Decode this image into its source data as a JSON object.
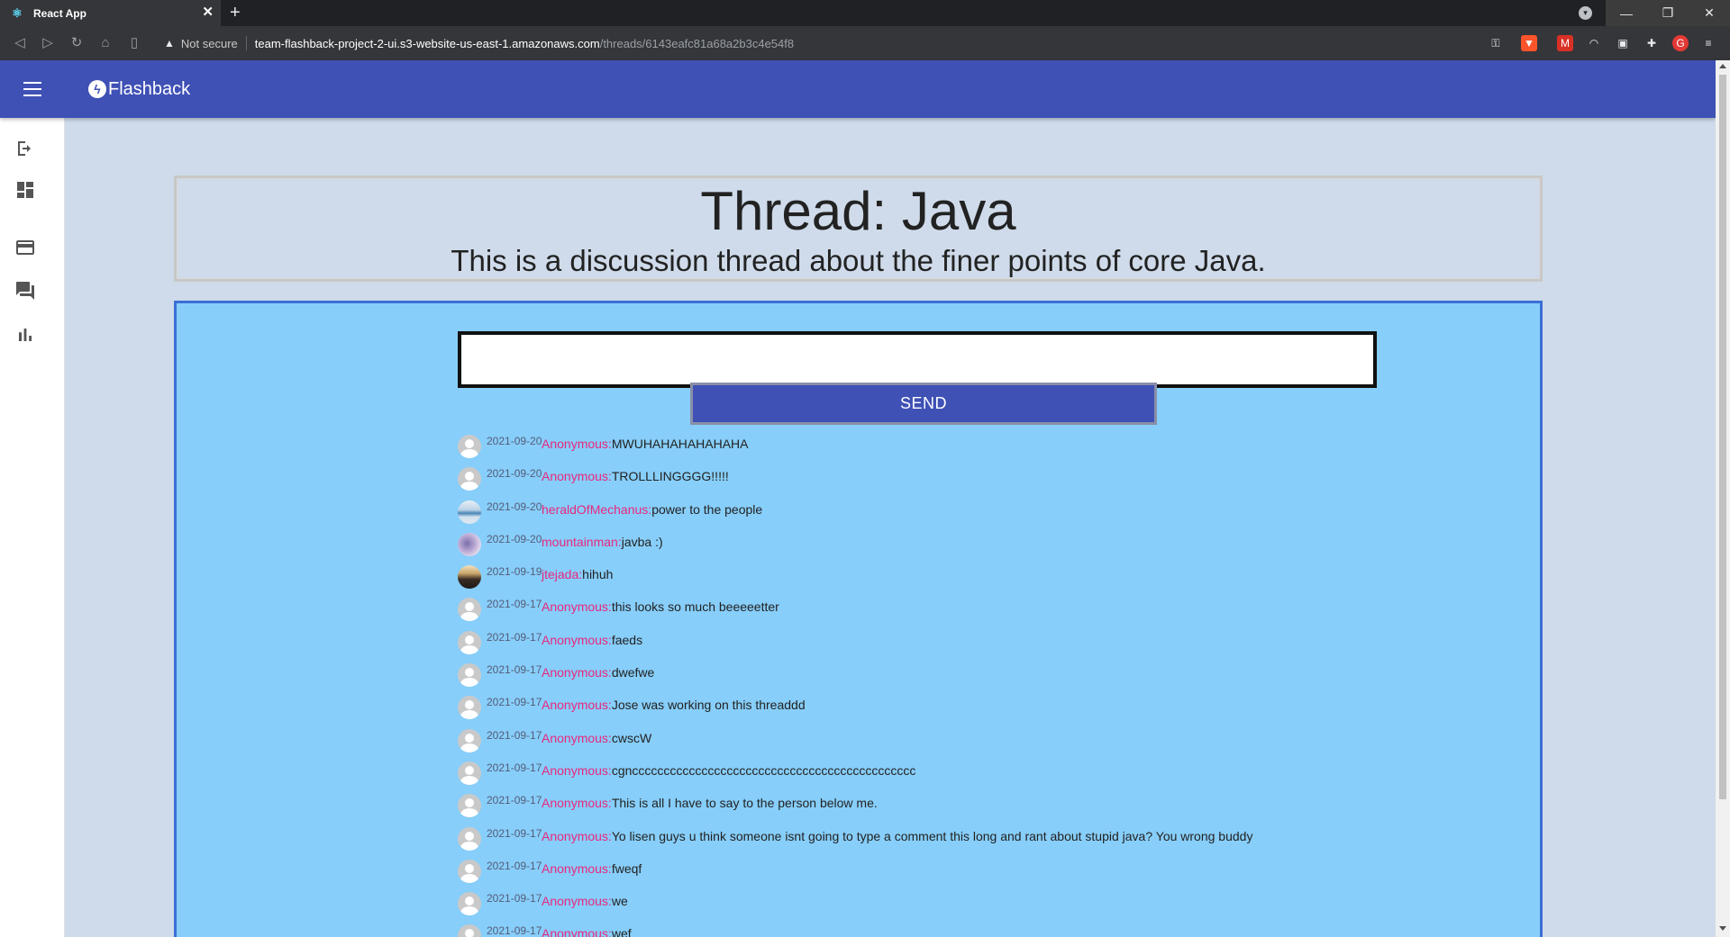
{
  "browser": {
    "tab_title": "React App",
    "security_label": "Not secure",
    "url_host": "team-flashback-project-2-ui.s3-website-us-east-1.amazonaws.com",
    "url_path": "/threads/6143eafc81a68a2b3c4e54f8"
  },
  "app": {
    "brand": "Flashback",
    "accent_color": "#3f51b5",
    "sidebar_icons": [
      "logout-icon",
      "dashboard-icon",
      "card-icon",
      "forum-icon",
      "bar-chart-icon"
    ]
  },
  "thread": {
    "title": "Thread: Java",
    "description": "This is a discussion thread about the finer points of core Java."
  },
  "chat": {
    "input_value": "",
    "send_label": "SEND",
    "messages": [
      {
        "date": "2021-09-20",
        "user": "Anonymous:",
        "text": "MWUHAHAHAHAHAHA",
        "avatar": "default"
      },
      {
        "date": "2021-09-20",
        "user": "Anonymous:",
        "text": "TROLLLINGGGG!!!!!",
        "avatar": "default"
      },
      {
        "date": "2021-09-20",
        "user": "heraldOfMechanus:",
        "text": "power to the people",
        "avatar": "sea"
      },
      {
        "date": "2021-09-20",
        "user": "mountainman:",
        "text": "javba :)",
        "avatar": "lilac"
      },
      {
        "date": "2021-09-19",
        "user": "jtejada:",
        "text": "hihuh",
        "avatar": "room"
      },
      {
        "date": "2021-09-17",
        "user": "Anonymous:",
        "text": "this looks so much beeeeetter",
        "avatar": "default"
      },
      {
        "date": "2021-09-17",
        "user": "Anonymous:",
        "text": "faeds",
        "avatar": "default"
      },
      {
        "date": "2021-09-17",
        "user": "Anonymous:",
        "text": "dwefwe",
        "avatar": "default"
      },
      {
        "date": "2021-09-17",
        "user": "Anonymous:",
        "text": "Jose was working on this threaddd",
        "avatar": "default"
      },
      {
        "date": "2021-09-17",
        "user": "Anonymous:",
        "text": "cwscW",
        "avatar": "default"
      },
      {
        "date": "2021-09-17",
        "user": "Anonymous:",
        "text": "cgnccccccccccccccccccccccccccccccccccccccccccccc",
        "avatar": "default"
      },
      {
        "date": "2021-09-17",
        "user": "Anonymous:",
        "text": "This is all I have to say to the person below me.",
        "avatar": "default"
      },
      {
        "date": "2021-09-17",
        "user": "Anonymous:",
        "text": "Yo lisen guys u think someone isnt going to type a comment this long and rant about stupid java? You wrong buddy",
        "avatar": "default"
      },
      {
        "date": "2021-09-17",
        "user": "Anonymous:",
        "text": "fweqf",
        "avatar": "default"
      },
      {
        "date": "2021-09-17",
        "user": "Anonymous:",
        "text": "we",
        "avatar": "default"
      },
      {
        "date": "2021-09-17",
        "user": "Anonymous:",
        "text": "wef",
        "avatar": "default"
      }
    ]
  }
}
